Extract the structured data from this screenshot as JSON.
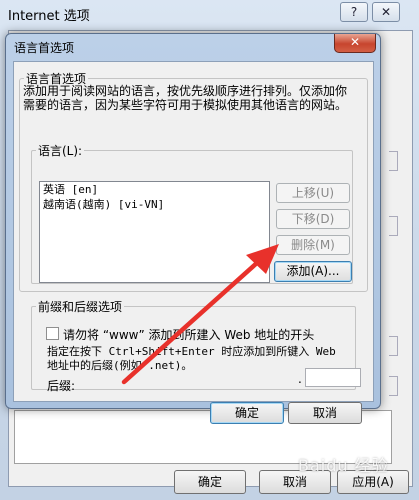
{
  "background_window": {
    "title": "Internet 选项",
    "help_glyph": "?",
    "close_glyph": "✕",
    "buttons": {
      "ok": "确定",
      "cancel": "取消",
      "apply": "应用(A)"
    },
    "watermark": "Baidu 经验"
  },
  "dialog": {
    "title": "语言首选项",
    "close_glyph": "✕",
    "language_group": {
      "legend": "语言首选项",
      "description": "添加用于阅读网站的语言，按优先级顺序进行排列。仅添加你需要的语言，因为某些字符可用于模拟使用其他语言的网站。",
      "list_label": "语言(L):",
      "languages": [
        "英语 [en]",
        "越南语(越南) [vi-VN]"
      ],
      "buttons": {
        "move_up": "上移(U)",
        "move_down": "下移(D)",
        "delete": "删除(M)",
        "add": "添加(A)..."
      }
    },
    "prefix_group": {
      "legend": "前缀和后缀选项",
      "checkbox_label": "请勿将 “www” 添加到所建入 Web 地址的开头",
      "hint": "指定在按下 Ctrl+Shift+Enter 时应添加到所键入 Web 地址中的后缀(例如 .net)。",
      "suffix_label": "后缀:",
      "suffix_dot": ".",
      "suffix_value": ""
    },
    "buttons": {
      "ok": "确定",
      "cancel": "取消"
    }
  },
  "colors": {
    "annotation_arrow": "#e8312b",
    "dialog_frame": "#a9c1de",
    "close_button": "#c7452e"
  }
}
